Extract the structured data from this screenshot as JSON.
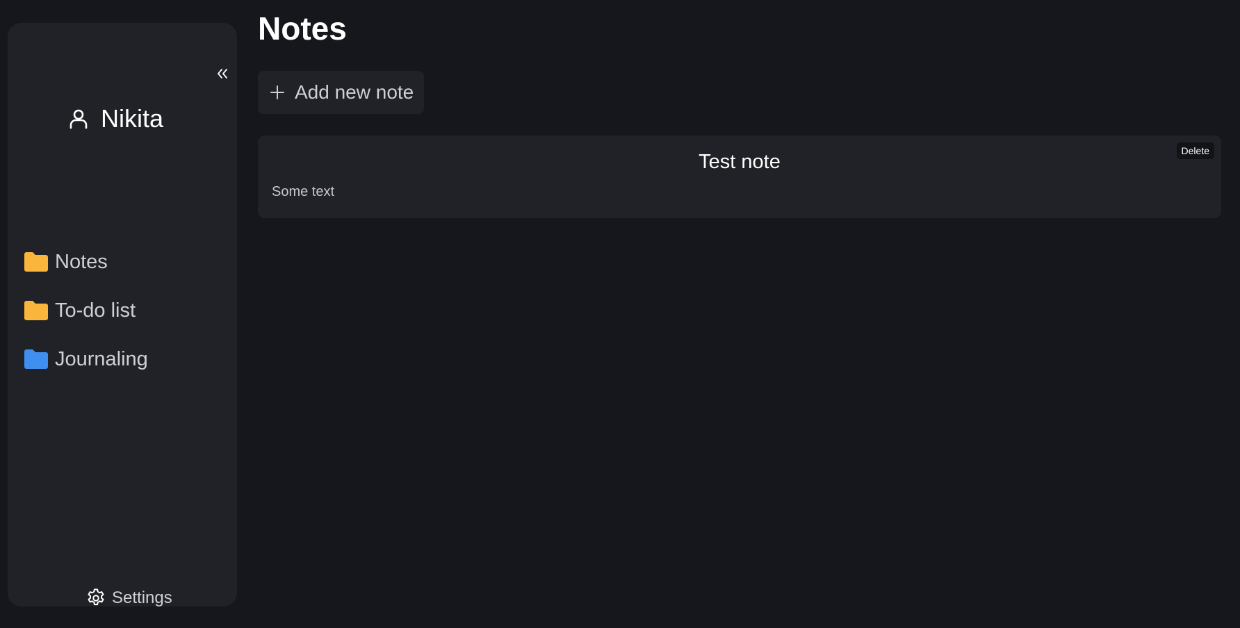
{
  "sidebar": {
    "collapse_icon": "double-chevron-left-icon",
    "user": {
      "icon": "user-icon",
      "name": "Nikita"
    },
    "items": [
      {
        "label": "Notes",
        "icon": "folder-icon",
        "color": "#f9b53c"
      },
      {
        "label": "To-do list",
        "icon": "folder-icon",
        "color": "#f9b53c"
      },
      {
        "label": "Journaling",
        "icon": "folder-icon",
        "color": "#3f8ff0"
      }
    ],
    "settings": {
      "icon": "gear-icon",
      "label": "Settings"
    }
  },
  "main": {
    "title": "Notes",
    "add_button": {
      "icon": "plus-icon",
      "label": "Add new note"
    },
    "notes": [
      {
        "title": "Test note",
        "body": "Some text",
        "delete_label": "Delete"
      }
    ]
  },
  "colors": {
    "background": "#16171c",
    "panel": "#212227",
    "folder_yellow": "#f9b53c",
    "folder_blue": "#3f8ff0"
  }
}
